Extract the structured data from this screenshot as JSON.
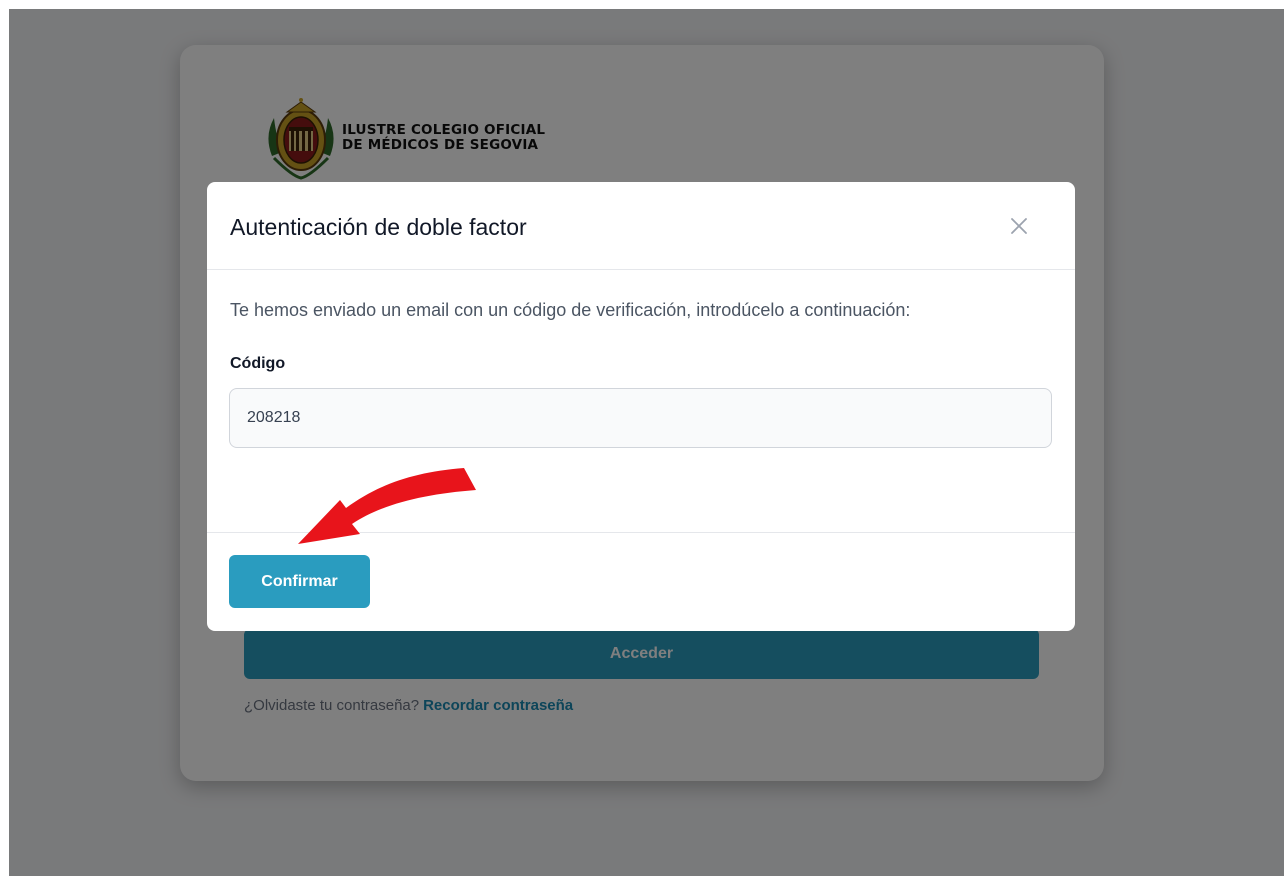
{
  "login": {
    "logo_line1": "ILUSTRE COLEGIO OFICIAL",
    "logo_line2": "DE MÉDICOS DE SEGOVIA",
    "submit_label": "Acceder",
    "forgot_text": "¿Olvidaste tu contraseña?",
    "forgot_link": "Recordar contraseña"
  },
  "modal": {
    "title": "Autenticación de doble factor",
    "description": "Te hemos enviado un email con un código de verificación, introdúcelo a continuación:",
    "code_label": "Código",
    "code_value": "208218",
    "confirm_label": "Confirmar",
    "close_icon": "close-icon"
  },
  "annotation": {
    "arrow_color": "#e8141b",
    "arrow_icon": "curved-arrow-icon"
  },
  "colors": {
    "primary": "#2a9cbf",
    "overlay": "rgba(0,0,0,0.5)"
  }
}
